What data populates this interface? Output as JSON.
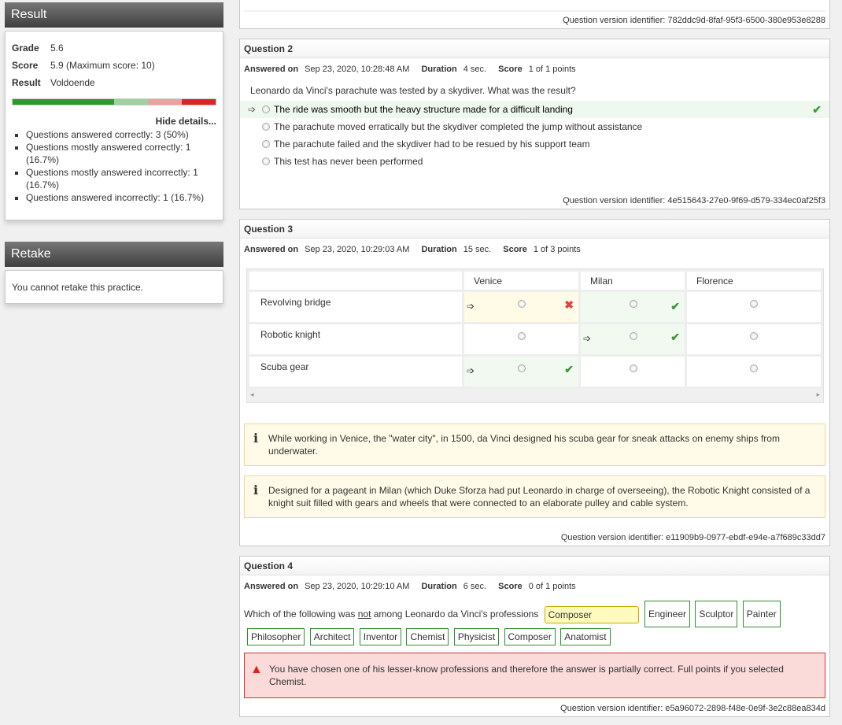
{
  "result": {
    "title": "Result",
    "grade_label": "Grade",
    "grade_value": "5.6",
    "score_label": "Score",
    "score_value": "5.9 (Maximum score: 10)",
    "result_label": "Result",
    "result_value": "Voldoende",
    "bar_segments": [
      {
        "fraction": 0.5,
        "color": "#2d9a2d"
      },
      {
        "fraction": 0.167,
        "color": "#9fd09f"
      },
      {
        "fraction": 0.167,
        "color": "#eca0a0"
      },
      {
        "fraction": 0.167,
        "color": "#dd2222"
      }
    ],
    "hide_details": "Hide details...",
    "details": [
      "Questions answered correctly: 3 (50%)",
      "Questions mostly answered correctly: 1 (16.7%)",
      "Questions mostly answered incorrectly: 1 (16.7%)",
      "Questions answered incorrectly: 1 (16.7%)"
    ]
  },
  "retake": {
    "title": "Retake",
    "message": "You cannot retake this practice."
  },
  "q1": {
    "version": "Question version identifier: 782ddc9d-8faf-95f3-6500-380e953e8288"
  },
  "q2": {
    "title": "Question 2",
    "answered_label": "Answered on",
    "answered_value": "Sep 23, 2020, 10:28:48 AM",
    "duration_label": "Duration",
    "duration_value": "4 sec.",
    "score_label": "Score",
    "score_value": "1 of 1 points",
    "text": "Leonardo da Vinci's parachute was tested by a skydiver. What was the result?",
    "options": [
      "The ride was smooth but the heavy structure made for a difficult landing",
      "The parachute moved erratically but the skydiver completed the jump without assistance",
      "The parachute failed and the skydiver had to be resued by his support team",
      "This test has never been performed"
    ],
    "version": "Question version identifier: 4e515643-27e0-9f69-d579-334ec0af25f3"
  },
  "q3": {
    "title": "Question 3",
    "answered_label": "Answered on",
    "answered_value": "Sep 23, 2020, 10:29:03 AM",
    "duration_label": "Duration",
    "duration_value": "15 sec.",
    "score_label": "Score",
    "score_value": "1 of 3 points",
    "columns": [
      "Venice",
      "Milan",
      "Florence"
    ],
    "rows": [
      "Revolving bridge",
      "Robotic knight",
      "Scuba gear"
    ],
    "hint1": "While working in Venice, the \"water city\", in 1500, da Vinci designed his scuba gear for sneak attacks on enemy ships from underwater.",
    "hint2": "Designed for a pageant in Milan (which Duke Sforza had put Leonardo in charge of overseeing), the Robotic Knight consisted of a knight suit filled with gears and wheels that were connected to an elaborate pulley and cable system.",
    "version": "Question version identifier: e11909b9-0977-ebdf-e94e-a7f689c33dd7"
  },
  "q4": {
    "title": "Question 4",
    "answered_label": "Answered on",
    "answered_value": "Sep 23, 2020, 10:29:10 AM",
    "duration_label": "Duration",
    "duration_value": "6 sec.",
    "score_label": "Score",
    "score_value": "0 of 1 points",
    "text_pre": "Which of the following was ",
    "text_not": "not",
    "text_post": " among Leonardo da Vinci's professions",
    "answer": "Composer",
    "chips_row1": [
      "Engineer",
      "Sculptor",
      "Painter"
    ],
    "chips_row2": [
      "Philosopher",
      "Architect",
      "Inventor",
      "Chemist",
      "Physicist",
      "Composer",
      "Anatomist"
    ],
    "feedback": "You have chosen one of his lesser-know professions and therefore the answer is partially correct. Full points if you selected Chemist.",
    "version": "Question version identifier: e5a96072-2898-f48e-0e9f-3e2c88ea834d"
  }
}
